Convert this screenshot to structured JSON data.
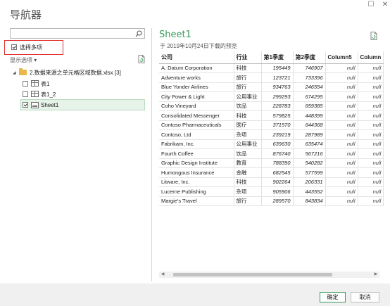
{
  "window": {
    "title": "导航器",
    "maximize_glyph": "☐",
    "close_glyph": "✕"
  },
  "left": {
    "search": {
      "value": "",
      "placeholder": ""
    },
    "select_multiple_label": "选择多项",
    "display_options_label": "显示选项 ▾",
    "tree": {
      "root_label": "2.数据来源之单元格区域数据.xlsx [3]",
      "items": [
        {
          "label": "表1",
          "checked": false
        },
        {
          "label": "表1_2",
          "checked": false
        },
        {
          "label": "Sheet1",
          "checked": true
        }
      ]
    }
  },
  "preview": {
    "title": "Sheet1",
    "subtitle": "于 2019年10月24日下载的预览",
    "columns": [
      "公司",
      "行业",
      "第1季度",
      "第2季度",
      "Column5",
      "Column"
    ],
    "rows": [
      [
        "A. Datum Corporation",
        "科技",
        "195449",
        "746907",
        "null",
        "null"
      ],
      [
        "Adventure works",
        "旅行",
        "123721",
        "733396",
        "null",
        "null"
      ],
      [
        "Blue Yonder Airlines",
        "旅行",
        "934763",
        "246554",
        "null",
        "null"
      ],
      [
        "City Power & Light",
        "公用事业",
        "299293",
        "674295",
        "null",
        "null"
      ],
      [
        "Coho Vineyard",
        "饮品",
        "228783",
        "659385",
        "null",
        "null"
      ],
      [
        "Consolidated Messenger",
        "科技",
        "579825",
        "448399",
        "null",
        "null"
      ],
      [
        "Contoso Pharmaceuticals",
        "医疗",
        "371570",
        "644368",
        "null",
        "null"
      ],
      [
        "Contoso, Ltd",
        "杂项",
        "239219",
        "287989",
        "null",
        "null"
      ],
      [
        "Fabrikam, Inc.",
        "公用事业",
        "639630",
        "635474",
        "null",
        "null"
      ],
      [
        "Fourth Coffee",
        "饮品",
        "876740",
        "567216",
        "null",
        "null"
      ],
      [
        "Graphic Design Institute",
        "教育",
        "788390",
        "540282",
        "null",
        "null"
      ],
      [
        "Humongous Insurance",
        "金融",
        "682545",
        "577599",
        "null",
        "null"
      ],
      [
        "Litware, Inc.",
        "科技",
        "902264",
        "206331",
        "null",
        "null"
      ],
      [
        "Lucerne Publishing",
        "杂项",
        "905906",
        "443552",
        "null",
        "null"
      ],
      [
        "Margie's Travel",
        "旅行",
        "289570",
        "843834",
        "null",
        "null"
      ]
    ]
  },
  "footer": {
    "ok_label": "确定",
    "cancel_label": "取消"
  },
  "icons": {
    "search": "search-icon",
    "refresh": "refresh-icon",
    "export": "export-icon",
    "folder": "folder-icon",
    "table": "table-icon",
    "sheet": "sheet-icon"
  },
  "colors": {
    "accent_green": "#3a9a5d",
    "highlight_red": "#e03030",
    "selected_row_bg": "#e6f3e9"
  }
}
